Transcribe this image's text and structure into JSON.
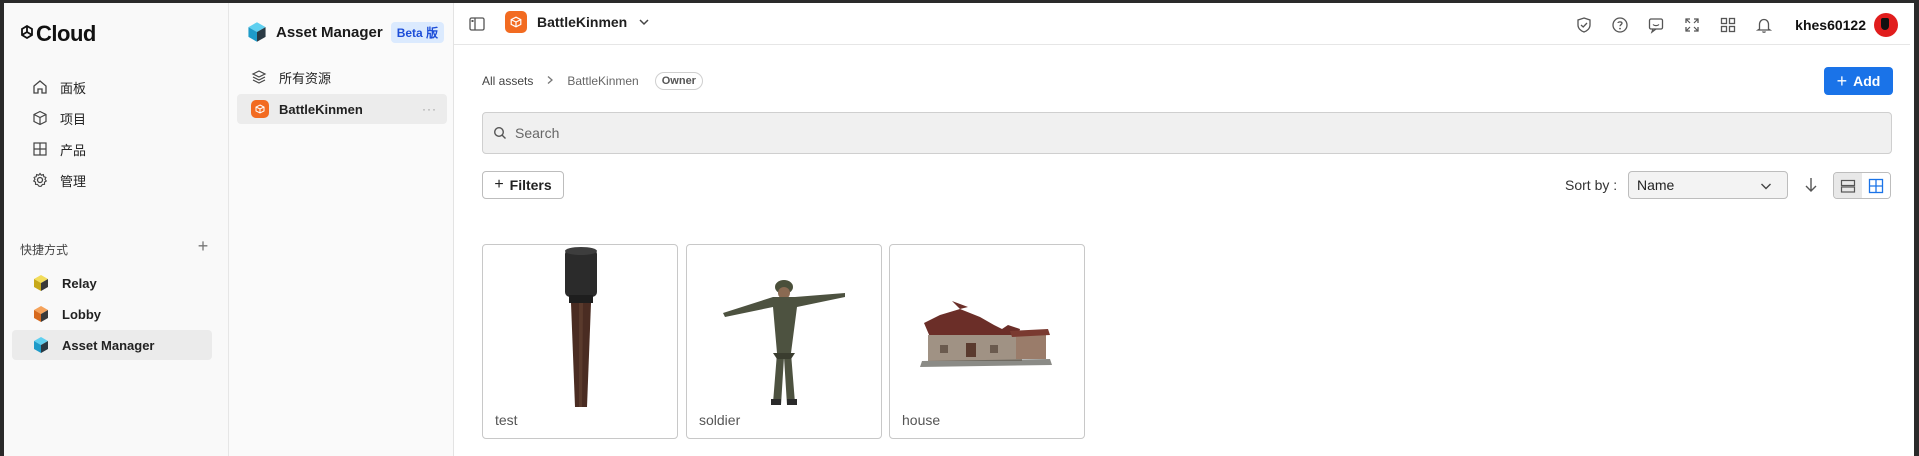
{
  "brand": {
    "name": "Cloud"
  },
  "nav": {
    "items": [
      {
        "label": "面板",
        "icon": "home-icon"
      },
      {
        "label": "项目",
        "icon": "cube-outline-icon"
      },
      {
        "label": "产品",
        "icon": "grid-icon"
      },
      {
        "label": "管理",
        "icon": "gear-icon"
      }
    ],
    "shortcuts_label": "快捷方式",
    "shortcuts": [
      {
        "label": "Relay",
        "color": "#d9c02a"
      },
      {
        "label": "Lobby",
        "color": "#e07b28"
      },
      {
        "label": "Asset Manager",
        "color": "#1e9bc9"
      }
    ]
  },
  "asset_manager": {
    "title": "Asset Manager",
    "beta": "Beta 版",
    "items": [
      {
        "label": "所有资源",
        "icon": "layers-icon"
      },
      {
        "label": "BattleKinmen",
        "more": "···"
      }
    ]
  },
  "topbar": {
    "project": "BattleKinmen",
    "username": "khes60122",
    "icons": [
      "shield-check-icon",
      "help-icon",
      "feedback-icon",
      "fullscreen-icon",
      "apps-grid-icon",
      "bell-icon"
    ]
  },
  "breadcrumb": {
    "root": "All assets",
    "current": "BattleKinmen",
    "role": "Owner"
  },
  "actions": {
    "add_label": "Add",
    "filters_label": "Filters"
  },
  "search": {
    "placeholder": "Search"
  },
  "sort": {
    "label": "Sort by :",
    "value": "Name"
  },
  "assets": [
    {
      "name": "test"
    },
    {
      "name": "soldier"
    },
    {
      "name": "house"
    }
  ],
  "colors": {
    "accent": "#1a73e8",
    "project_badge": "#f26b21",
    "beta_bg": "#dbeafe",
    "beta_text": "#1d4ed8"
  }
}
